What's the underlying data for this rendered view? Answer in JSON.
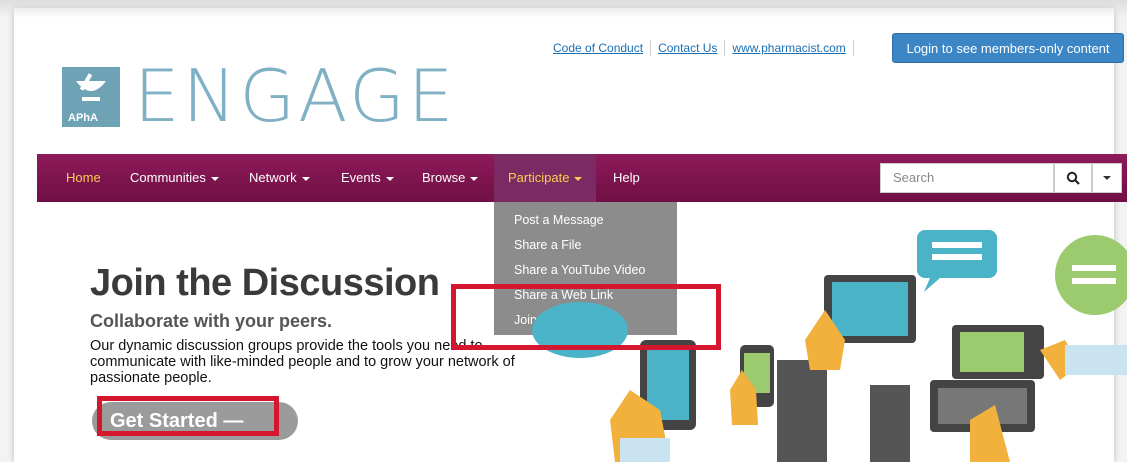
{
  "top_links": [
    "Code of Conduct",
    "Contact Us",
    "www.pharmacist.com"
  ],
  "login_button": "Login to see members-only content",
  "logo": {
    "brand": "ENGAGE",
    "badge": "APhA"
  },
  "nav": {
    "items": [
      {
        "label": "Home"
      },
      {
        "label": "Communities"
      },
      {
        "label": "Network"
      },
      {
        "label": "Events"
      },
      {
        "label": "Browse"
      },
      {
        "label": "Participate"
      },
      {
        "label": "Help"
      }
    ],
    "search_placeholder": "Search"
  },
  "dropdown": {
    "items": [
      "Post a Message",
      "Share a File",
      "Share a YouTube Video",
      "Share a Web Link",
      "Join a Community"
    ]
  },
  "hero": {
    "title": "Join the Discussion",
    "subtitle": "Collaborate with your peers.",
    "body": "Our dynamic discussion groups provide the tools you need to communicate with like-minded people and to grow your network of passionate people.",
    "cta": "Get Started —"
  },
  "colors": {
    "nav_bg": "#801553",
    "accent_yellow": "#f5d04a",
    "login_blue": "#3d86c6",
    "highlight_red": "#d4172e"
  }
}
